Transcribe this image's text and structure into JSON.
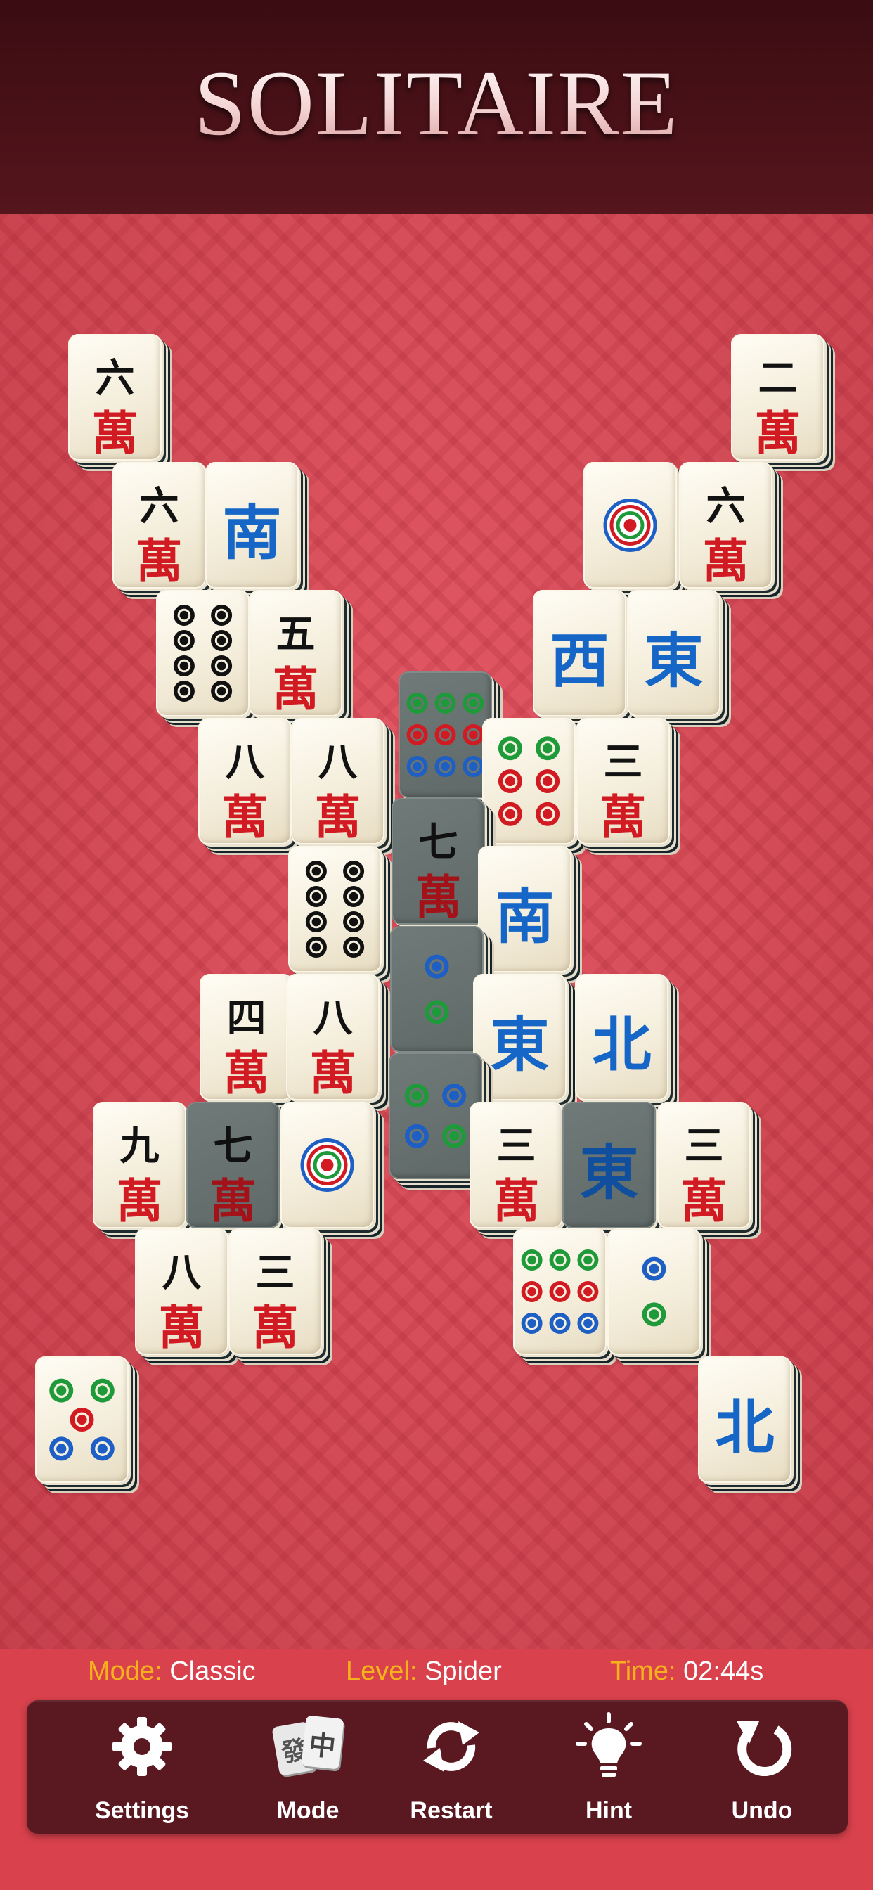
{
  "header": {
    "title": "SOLITAIRE"
  },
  "status": {
    "mode_label": "Mode:",
    "mode_value": "Classic",
    "level_label": "Level:",
    "level_value": "Spider",
    "time_label": "Time:",
    "time_value": "02:44s"
  },
  "toolbar": {
    "settings_label": "Settings",
    "mode_label": "Mode",
    "mode_icon_chars": [
      "發",
      "中"
    ],
    "restart_label": "Restart",
    "hint_label": "Hint",
    "undo_label": "Undo"
  },
  "colors": {
    "header_bg": "#3a0d12",
    "board_bg": "#e04a57",
    "status_label": "#f5b21c",
    "toolbar_bg": "#5a1820",
    "char_red": "#d11a22",
    "wind_blue": "#1566c6",
    "dot_green": "#1f9a3a",
    "dot_red": "#d11a22",
    "dot_blue": "#1d5fc4"
  },
  "tiles": [
    {
      "kind": "char",
      "top": "六",
      "bottom": "萬",
      "state": "free"
    },
    {
      "kind": "char",
      "top": "二",
      "bottom": "萬",
      "state": "free"
    },
    {
      "kind": "char",
      "top": "六",
      "bottom": "萬",
      "state": "free"
    },
    {
      "kind": "honor",
      "char": "南",
      "state": "free"
    },
    {
      "kind": "dot",
      "count": 1,
      "state": "free"
    },
    {
      "kind": "char",
      "top": "六",
      "bottom": "萬",
      "state": "free"
    },
    {
      "kind": "dot",
      "count": 8,
      "color": "black",
      "state": "free"
    },
    {
      "kind": "char",
      "top": "五",
      "bottom": "萬",
      "state": "free"
    },
    {
      "kind": "honor",
      "char": "西",
      "state": "free"
    },
    {
      "kind": "honor",
      "char": "東",
      "state": "free"
    },
    {
      "kind": "dot",
      "count": 9,
      "state": "blocked"
    },
    {
      "kind": "char",
      "top": "八",
      "bottom": "萬",
      "state": "free"
    },
    {
      "kind": "char",
      "top": "八",
      "bottom": "萬",
      "state": "free"
    },
    {
      "kind": "dot",
      "count": 6,
      "state": "free"
    },
    {
      "kind": "char",
      "top": "三",
      "bottom": "萬",
      "state": "free"
    },
    {
      "kind": "char",
      "top": "七",
      "bottom": "萬",
      "state": "blocked"
    },
    {
      "kind": "dot",
      "count": 8,
      "color": "black",
      "state": "free"
    },
    {
      "kind": "honor",
      "char": "南",
      "state": "free"
    },
    {
      "kind": "dot",
      "count": 2,
      "state": "blocked"
    },
    {
      "kind": "char",
      "top": "四",
      "bottom": "萬",
      "state": "free"
    },
    {
      "kind": "char",
      "top": "八",
      "bottom": "萬",
      "state": "free"
    },
    {
      "kind": "honor",
      "char": "東",
      "state": "free"
    },
    {
      "kind": "honor",
      "char": "北",
      "state": "free"
    },
    {
      "kind": "dot",
      "count": 4,
      "state": "blocked"
    },
    {
      "kind": "char",
      "top": "九",
      "bottom": "萬",
      "state": "free"
    },
    {
      "kind": "char",
      "top": "七",
      "bottom": "萬",
      "state": "blocked"
    },
    {
      "kind": "dot",
      "count": 1,
      "state": "free"
    },
    {
      "kind": "char",
      "top": "三",
      "bottom": "萬",
      "state": "free"
    },
    {
      "kind": "honor",
      "char": "東",
      "state": "blocked"
    },
    {
      "kind": "char",
      "top": "三",
      "bottom": "萬",
      "state": "free"
    },
    {
      "kind": "char",
      "top": "八",
      "bottom": "萬",
      "state": "free"
    },
    {
      "kind": "char",
      "top": "三",
      "bottom": "萬",
      "state": "free"
    },
    {
      "kind": "dot",
      "count": 9,
      "state": "free"
    },
    {
      "kind": "dot",
      "count": 2,
      "state": "free"
    },
    {
      "kind": "dot",
      "count": 5,
      "state": "free"
    },
    {
      "kind": "honor",
      "char": "北",
      "state": "free"
    }
  ]
}
